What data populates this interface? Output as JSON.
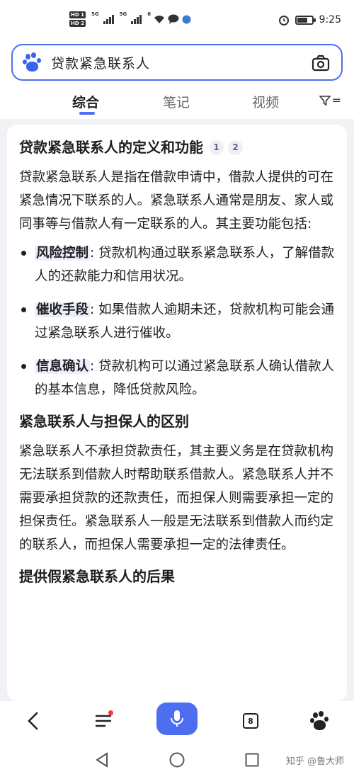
{
  "status_bar": {
    "hd1": "HD 1",
    "hd2": "HD 2",
    "net1": "5G",
    "net2": "5G",
    "wifi_tag": "6",
    "time": "9:25"
  },
  "search": {
    "query": "贷款紧急联系人"
  },
  "tabs": [
    {
      "label": "综合",
      "active": true
    },
    {
      "label": "笔记",
      "active": false
    },
    {
      "label": "视频",
      "active": false
    }
  ],
  "filter_label": "=",
  "article": {
    "section1": {
      "title": "贷款紧急联系人的定义和功能",
      "citations": [
        "1",
        "2"
      ],
      "intro": "贷款紧急联系人是指在借款申请中，借款人提供的可在紧急情况下联系的人。紧急联系人通常是朋友、家人或同事等与借款人有一定联系的人。其主要功能包括:",
      "bullets": [
        {
          "term": "风险控制",
          "text": ": 贷款机构通过联系紧急联系人，了解借款人的还款能力和信用状况。"
        },
        {
          "term": "催收手段",
          "text": ": 如果借款人逾期未还，贷款机构可能会通过紧急联系人进行催收。"
        },
        {
          "term": "信息确认",
          "text": ": 贷款机构可以通过紧急联系人确认借款人的基本信息，降低贷款风险。"
        }
      ]
    },
    "section2": {
      "title": "紧急联系人与担保人的区别",
      "body": "紧急联系人不承担贷款责任，其主要义务是在贷款机构无法联系到借款人时帮助联系借款人。紧急联系人并不需要承担贷款的还款责任，而担保人则需要承担一定的担保责任。紧急联系人一般是无法联系到借款人而约定的联系人，而担保人需要承担一定的法律责任。"
    },
    "section3": {
      "title": "提供假紧急联系人的后果"
    }
  },
  "toolbar": {
    "tab_count": "8"
  },
  "watermark": "知乎 @鲁大师",
  "colors": {
    "accent": "#4e6ef2",
    "highlight_bg": "#eceefb",
    "page_bg": "#f1f2f6"
  }
}
